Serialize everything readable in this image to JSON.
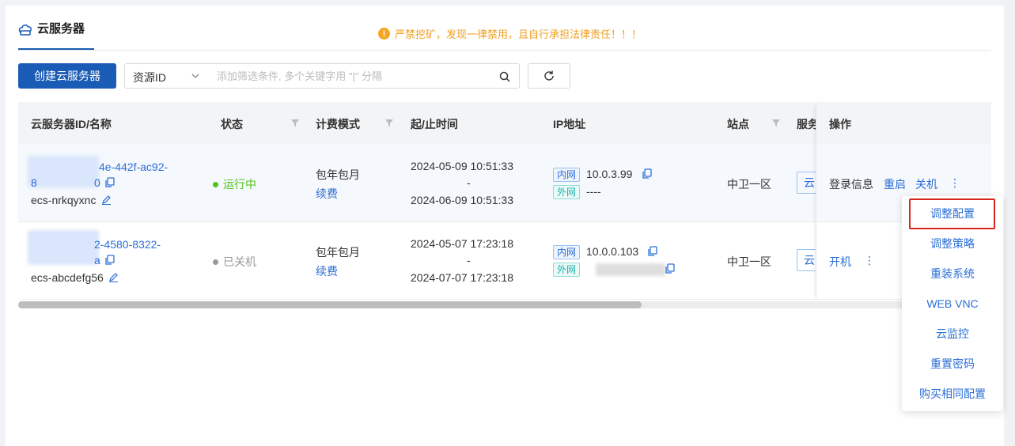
{
  "tab": {
    "label": "云服务器"
  },
  "warning": {
    "text": "严禁挖矿，发现一律禁用，且自行承担法律责任！！！"
  },
  "toolbar": {
    "create_label": "创建云服务器",
    "filter_field": "资源ID",
    "filter_placeholder": "添加筛选条件, 多个关键字用 \"|\" 分隔"
  },
  "table": {
    "headers": {
      "id_name": "云服务器ID/名称",
      "status": "状态",
      "billing": "计费模式",
      "time": "起/止时间",
      "ip": "IP地址",
      "site": "站点",
      "service": "服务",
      "ops": "操作"
    },
    "rows": [
      {
        "id_part1": "4e-442f-ac92-",
        "id_part2": "8",
        "id_part3": "0",
        "name": "ecs-nrkqyxnc",
        "status": "运行中",
        "status_color": "#52c41a",
        "billing": "包年包月",
        "renew": "续费",
        "start": "2024-05-09 10:51:33",
        "dash": "-",
        "end": "2024-06-09 10:51:33",
        "tag_in": "内网",
        "ip_in": "10.0.3.99",
        "tag_out": "外网",
        "ip_out": "----",
        "site": "中卫一区",
        "service": "云",
        "ops": [
          "登录信息",
          "重启",
          "关机"
        ],
        "more": "⋮"
      },
      {
        "id_part1": "2-4580-8322-",
        "id_part2": "",
        "id_part3": "a",
        "name": "ecs-abcdefg56",
        "status": "已关机",
        "status_color": "#999999",
        "billing": "包年包月",
        "renew": "续费",
        "start": "2024-05-07 17:23:18",
        "dash": "-",
        "end": "2024-07-07 17:23:18",
        "tag_in": "内网",
        "ip_in": "10.0.0.103",
        "tag_out": "外网",
        "ip_out": "",
        "site": "中卫一区",
        "service": "云",
        "ops": [
          "开机"
        ],
        "more": "⋮"
      }
    ]
  },
  "dropdown": {
    "items": [
      "调整配置",
      "调整策略",
      "重装系统",
      "WEB VNC",
      "云监控",
      "重置密码",
      "购买相同配置"
    ],
    "selected_index": 0
  },
  "colors": {
    "primary": "#1a5bb5",
    "link": "#2b6fd6",
    "warning": "#f0a020",
    "highlight": "#d9261c"
  }
}
